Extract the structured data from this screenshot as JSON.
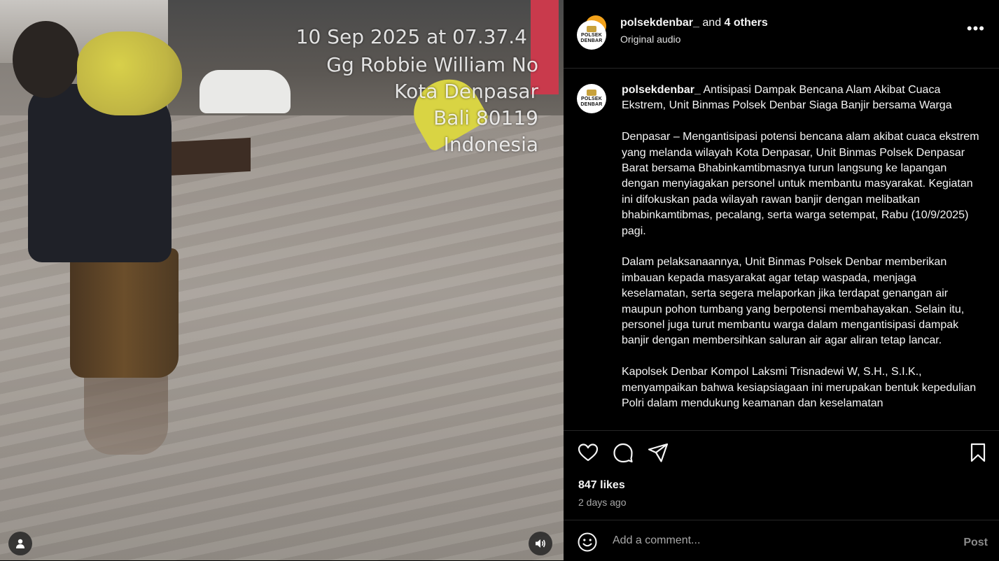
{
  "media": {
    "overlay_lines": [
      "10 Sep 2025 at 07.37.4",
      "Gg Robbie William No",
      "Kota Denpasar",
      "Bali 80119",
      "Indonesia"
    ]
  },
  "post": {
    "avatar_text": "POLSEK DENBAR",
    "header": {
      "username": "polsekdenbar_",
      "and_text": "and",
      "others_text": "4 others",
      "audio": "Original audio",
      "more": "•••"
    },
    "caption": {
      "username": "polsekdenbar_",
      "title": "Antisipasi Dampak Bencana Alam Akibat Cuaca Ekstrem, Unit Binmas Polsek Denbar Siaga Banjir bersama Warga",
      "paragraphs": [
        "Denpasar – Mengantisipasi potensi bencana alam akibat cuaca ekstrem yang melanda wilayah Kota Denpasar, Unit Binmas Polsek Denpasar Barat bersama Bhabinkamtibmasnya turun langsung ke lapangan dengan menyiagakan personel untuk membantu masyarakat. Kegiatan ini difokuskan pada wilayah rawan banjir dengan melibatkan bhabinkamtibmas, pecalang, serta warga setempat, Rabu (10/9/2025) pagi.",
        "Dalam pelaksanaannya, Unit Binmas Polsek Denbar memberikan imbauan kepada masyarakat agar tetap waspada, menjaga keselamatan, serta segera melaporkan jika terdapat genangan air maupun pohon tumbang yang berpotensi membahayakan. Selain itu, personel juga turut membantu warga dalam mengantisipasi dampak banjir dengan membersihkan saluran air agar aliran tetap lancar.",
        "Kapolsek Denbar Kompol Laksmi Trisnadewi W, S.H., S.I.K., menyampaikan bahwa kesiapsiagaan ini merupakan bentuk kepedulian Polri dalam mendukung keamanan dan keselamatan"
      ]
    },
    "likes": "847 likes",
    "time_ago": "2 days ago",
    "comment": {
      "placeholder": "Add a comment...",
      "post_label": "Post"
    }
  },
  "colors": {
    "panel_bg": "#000000",
    "text": "#f5f5f5",
    "muted": "#a8a8a8",
    "divider": "#262626",
    "story_ring": "#f2a21b"
  },
  "icons": [
    "user-tag-icon",
    "speaker-icon",
    "heart-icon",
    "comment-icon",
    "share-icon",
    "bookmark-icon",
    "emoji-icon",
    "more-icon"
  ]
}
